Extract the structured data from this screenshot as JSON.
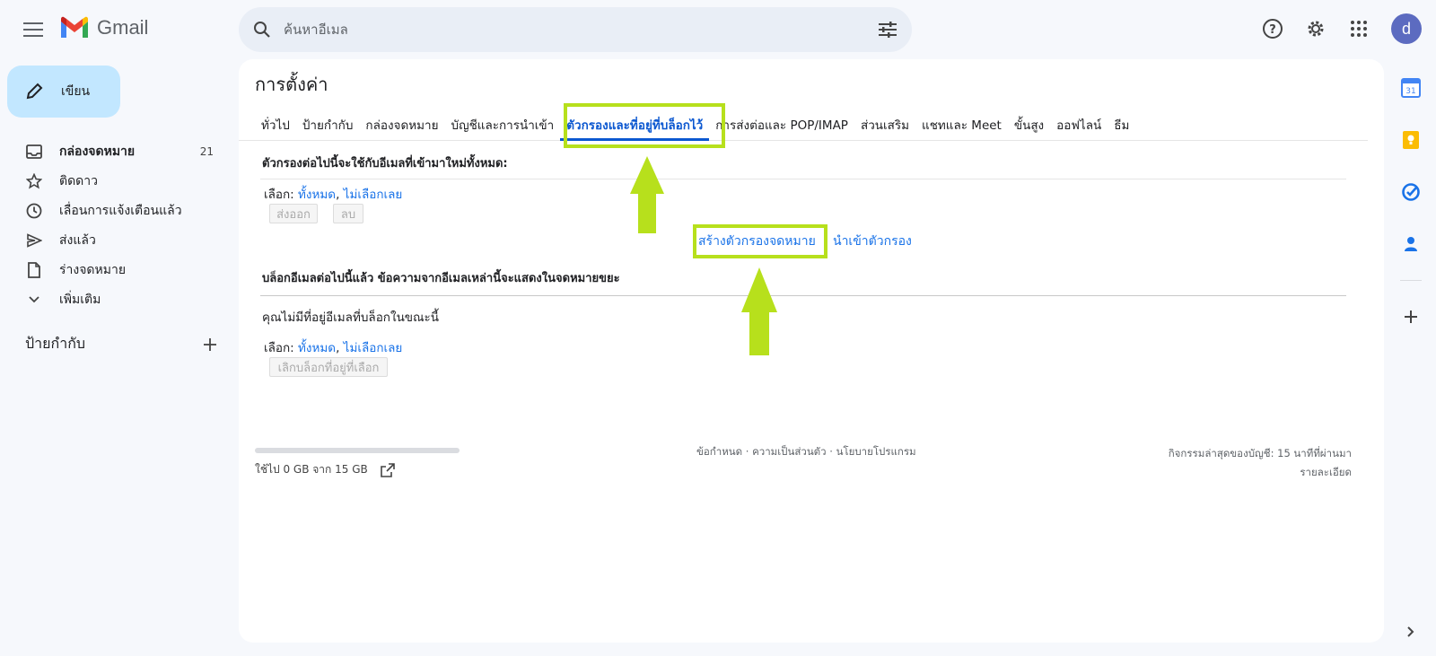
{
  "header": {
    "app_name": "Gmail",
    "search_placeholder": "ค้นหาอีเมล",
    "avatar_letter": "d"
  },
  "sidebar": {
    "compose_label": "เขียน",
    "items": [
      {
        "label": "กล่องจดหมาย",
        "count": "21",
        "icon": "inbox-icon"
      },
      {
        "label": "ติดดาว",
        "icon": "star-icon"
      },
      {
        "label": "เลื่อนการแจ้งเตือนแล้ว",
        "icon": "clock-icon"
      },
      {
        "label": "ส่งแล้ว",
        "icon": "send-icon"
      },
      {
        "label": "ร่างจดหมาย",
        "icon": "draft-icon"
      },
      {
        "label": "เพิ่มเติม",
        "icon": "chevron-down-icon"
      }
    ],
    "labels_heading": "ป้ายกำกับ"
  },
  "settings": {
    "title": "การตั้งค่า",
    "tabs": [
      "ทั่วไป",
      "ป้ายกำกับ",
      "กล่องจดหมาย",
      "บัญชีและการนำเข้า",
      "ตัวกรองและที่อยู่ที่บล็อกไว้",
      "การส่งต่อและ POP/IMAP",
      "ส่วนเสริม",
      "แชทและ Meet",
      "ขั้นสูง",
      "ออฟไลน์",
      "ธีม"
    ],
    "active_tab": "ตัวกรองและที่อยู่ที่บล็อกไว้",
    "filters_heading": "ตัวกรองต่อไปนี้จะใช้กับอีเมลที่เข้ามาใหม่ทั้งหมด:",
    "select_label": "เลือก:",
    "select_all": "ทั้งหมด",
    "select_none": "ไม่เลือกเลย",
    "export_button": "ส่งออก",
    "delete_button": "ลบ",
    "create_filter": "สร้างตัวกรองจดหมาย",
    "import_filters": "นำเข้าตัวกรอง",
    "blocked_heading": "บล็อกอีเมลต่อไปนี้แล้ว ข้อความจากอีเมลเหล่านี้จะแสดงในจดหมายขยะ",
    "no_blocked": "คุณไม่มีที่อยู่อีเมลที่บล็อกในขณะนี้",
    "unblock_button": "เลิกบล็อกที่อยู่ที่เลือก"
  },
  "footer": {
    "storage": "ใช้ไป 0 GB จาก 15 GB",
    "storage_used_fraction": 0.0,
    "links": "ข้อกำหนด · ความเป็นส่วนตัว · นโยบายโปรแกรม",
    "last_activity": "กิจกรรมล่าสุดของบัญชี: 15 นาทีที่ผ่านมา",
    "details": "รายละเอียด"
  },
  "colors": {
    "highlight": "#b7e01c",
    "link": "#1a73e8",
    "compose_bg": "#c2e7ff"
  }
}
